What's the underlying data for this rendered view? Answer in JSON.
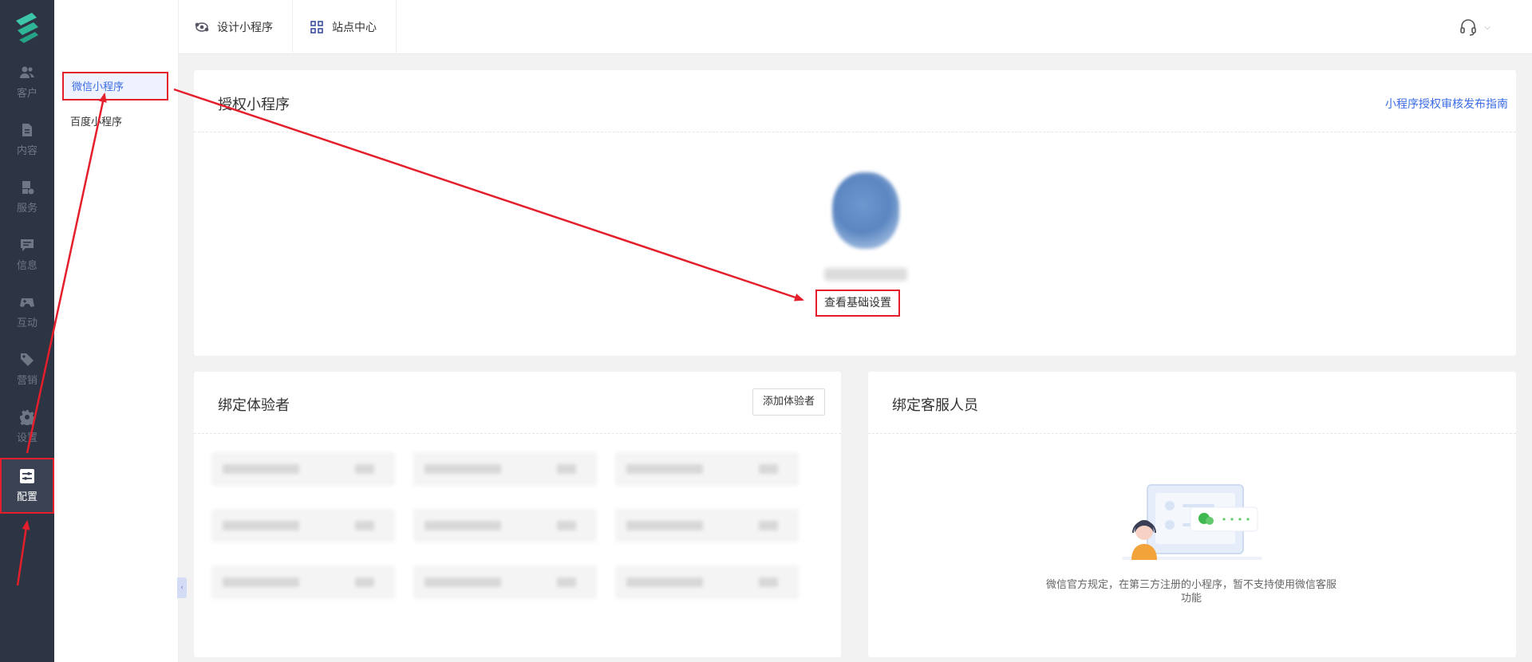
{
  "rail": {
    "items": [
      {
        "label": "客户",
        "icon": "users-icon"
      },
      {
        "label": "内容",
        "icon": "document-icon"
      },
      {
        "label": "服务",
        "icon": "service-icon"
      },
      {
        "label": "信息",
        "icon": "message-icon"
      },
      {
        "label": "互动",
        "icon": "gamepad-icon"
      },
      {
        "label": "营销",
        "icon": "tag-icon"
      },
      {
        "label": "设置",
        "icon": "gear-icon"
      },
      {
        "label": "配置",
        "icon": "config-icon"
      }
    ],
    "active": "配置"
  },
  "subnav": {
    "items": [
      {
        "label": "微信小程序"
      },
      {
        "label": "百度小程序"
      }
    ],
    "active": "微信小程序"
  },
  "topbar": {
    "tabs": [
      {
        "label": "设计小程序",
        "icon": "design-icon"
      },
      {
        "label": "站点中心",
        "icon": "grid-icon"
      }
    ],
    "support_icon": "headset-icon"
  },
  "authorize_card": {
    "title": "授权小程序",
    "guide_link": "小程序授权审核发布指南",
    "view_button": "查看基础设置"
  },
  "testers_card": {
    "title": "绑定体验者",
    "add_button": "添加体验者"
  },
  "cs_card": {
    "title": "绑定客服人员",
    "note": "微信官方规定，在第三方注册的小程序，暂不支持使用微信客服功能"
  },
  "colors": {
    "accent": "#3b6de6",
    "annotation_red": "#e41e2b",
    "rail_bg": "#2d3443",
    "logo_green": "#3ec6a8"
  }
}
